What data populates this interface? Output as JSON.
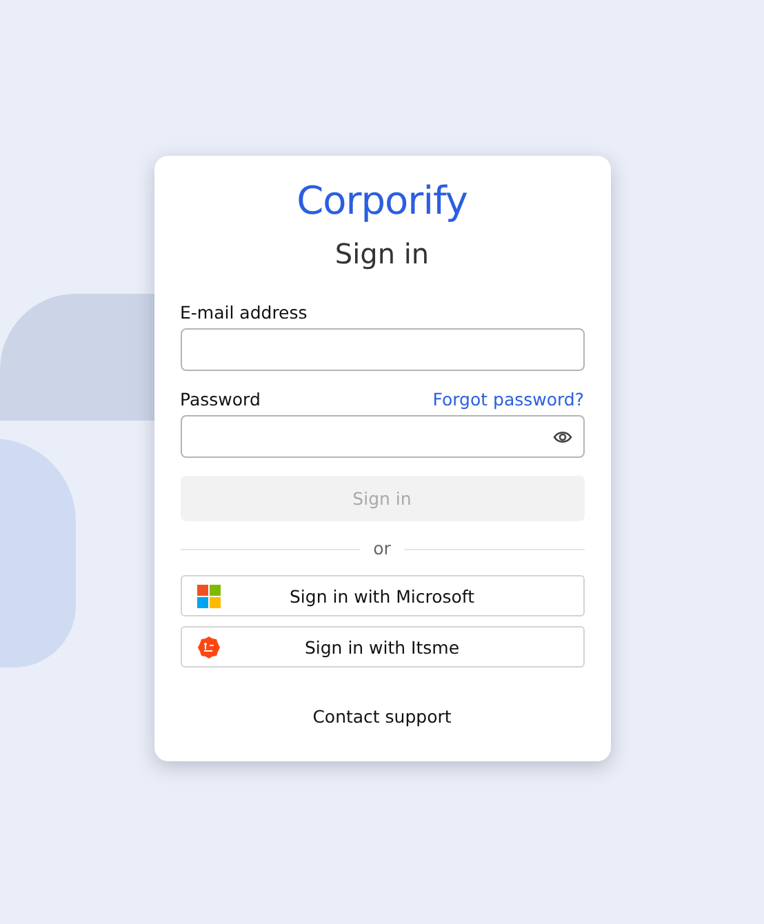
{
  "logo": "Corporify",
  "title": "Sign in",
  "email": {
    "label": "E-mail address"
  },
  "password": {
    "label": "Password",
    "forgot_link": "Forgot password?"
  },
  "submit": {
    "label": "Sign in",
    "disabled": true
  },
  "divider": "or",
  "providers": [
    {
      "kind": "microsoft",
      "label": "Sign in with Microsoft"
    },
    {
      "kind": "itsme",
      "label": "Sign in with Itsme"
    }
  ],
  "contact_support": "Contact support"
}
